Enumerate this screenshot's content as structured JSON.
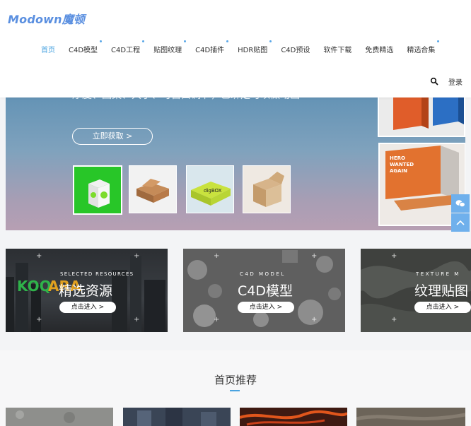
{
  "header": {
    "logo": "Modown魔顿",
    "nav": [
      {
        "label": "首页",
        "active": true,
        "dot": false
      },
      {
        "label": "C4D模型",
        "active": false,
        "dot": true
      },
      {
        "label": "C4D工程",
        "active": false,
        "dot": true
      },
      {
        "label": "贴图纹理",
        "active": false,
        "dot": true
      },
      {
        "label": "C4D插件",
        "active": false,
        "dot": true
      },
      {
        "label": "HDR贴图",
        "active": false,
        "dot": true
      },
      {
        "label": "C4D预设",
        "active": false,
        "dot": false
      },
      {
        "label": "软件下载",
        "active": false,
        "dot": false
      },
      {
        "label": "免费精选",
        "active": false,
        "dot": false
      },
      {
        "label": "精选合集",
        "active": false,
        "dot": true
      }
    ],
    "login_label": "登录",
    "search_icon": "search-icon"
  },
  "hero": {
    "tagline": "厚度、图案、大小、可自由调节，已绑定可以做动画",
    "button_label": "立即获取 >"
  },
  "categories": [
    {
      "small": "SELECTED RESOURCES",
      "title": "精选资源",
      "button": "点击进入 >"
    },
    {
      "small": "C4D MODEL",
      "title": "C4D模型",
      "button": "点击进入 >"
    },
    {
      "small": "TEXTURE M",
      "title": "纹理贴图",
      "button": "点击进入 >"
    }
  ],
  "section": {
    "title": "首页推荐"
  },
  "colors": {
    "accent": "#4aa3e0",
    "float": "#6fb0ec"
  }
}
